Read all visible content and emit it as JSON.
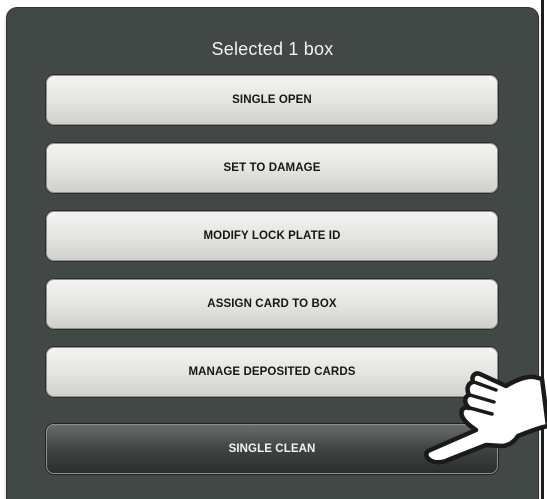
{
  "dialog": {
    "title": "Selected 1 box",
    "buttons": [
      {
        "label": "SINGLE OPEN"
      },
      {
        "label": "SET TO DAMAGE"
      },
      {
        "label": "MODIFY LOCK PLATE ID"
      },
      {
        "label": "ASSIGN CARD TO BOX"
      },
      {
        "label": "MANAGE DEPOSITED CARDS"
      },
      {
        "label": "SINGLE CLEAN"
      }
    ]
  },
  "colors": {
    "dialog_background": "#424846",
    "button_light": "#e3e3e0",
    "button_dark_pressed": "#3f4341",
    "text_dark": "#161616",
    "text_light": "#f4f4f4"
  },
  "pointer": {
    "icon": "hand-pointer-icon"
  }
}
